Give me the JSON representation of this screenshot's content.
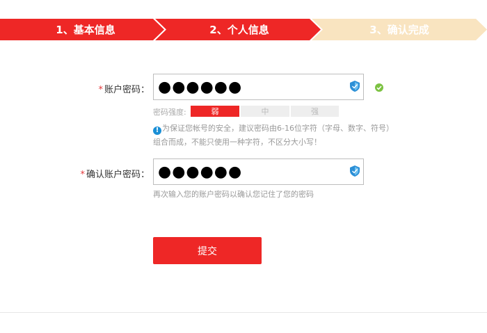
{
  "steps": [
    {
      "label": "1、基本信息",
      "state": "done"
    },
    {
      "label": "2、个人信息",
      "state": "active"
    },
    {
      "label": "3、确认完成",
      "state": "pending"
    }
  ],
  "form": {
    "required_mark": "*",
    "password": {
      "label": "账户密码：",
      "value": "●●●●●●"
    },
    "strength": {
      "label": "密码强度:",
      "levels": [
        "弱",
        "中",
        "强"
      ],
      "current": "弱"
    },
    "password_tip": {
      "icon": "!",
      "line1": "为保证您帐号的安全，建议密码由6-16位字符（字母、数字、符号）",
      "line2": "组合而成，不能只使用一种字符，不区分大小写！"
    },
    "confirm": {
      "label": "确认账户密码：",
      "value": "●●●●●●"
    },
    "confirm_tip": "再次输入您的账户密码以确认您记住了您的密码",
    "submit_label": "提交"
  },
  "colors": {
    "accent": "#ee2726",
    "pending_step": "#f9e4c0",
    "info": "#1a8fd6",
    "ok": "#7cc242"
  }
}
